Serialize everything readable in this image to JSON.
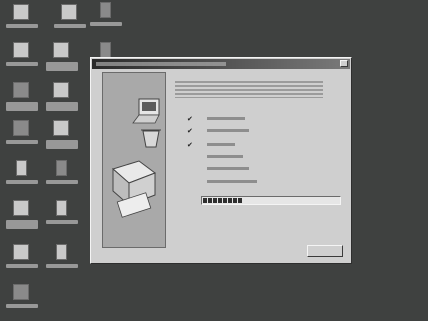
{
  "desktop": {
    "background": "#3f4140"
  },
  "desktop_icons": [
    {
      "icon": "computer-icon"
    },
    {
      "icon": "network-icon"
    },
    {
      "icon": "recycle-bin-icon"
    },
    {
      "icon": "folder-icon"
    },
    {
      "icon": "mail-icon"
    },
    {
      "icon": "shortcut-icon"
    },
    {
      "icon": "globe-icon"
    },
    {
      "icon": "document-icon"
    },
    {
      "icon": "console-icon"
    },
    {
      "icon": "setup-icon"
    },
    {
      "icon": "installer-icon"
    }
  ],
  "dialog": {
    "steps": [
      {
        "done": true
      },
      {
        "done": true
      },
      {
        "done": true
      },
      {
        "done": false
      },
      {
        "done": false
      },
      {
        "done": false
      }
    ],
    "progress": 0.3
  },
  "colors": {
    "dialog_face": "#cfcfcf",
    "titlebar_start": "#2a2a2a",
    "titlebar_end": "#7a7a7a",
    "progress_fill": "#2f2f2f"
  }
}
